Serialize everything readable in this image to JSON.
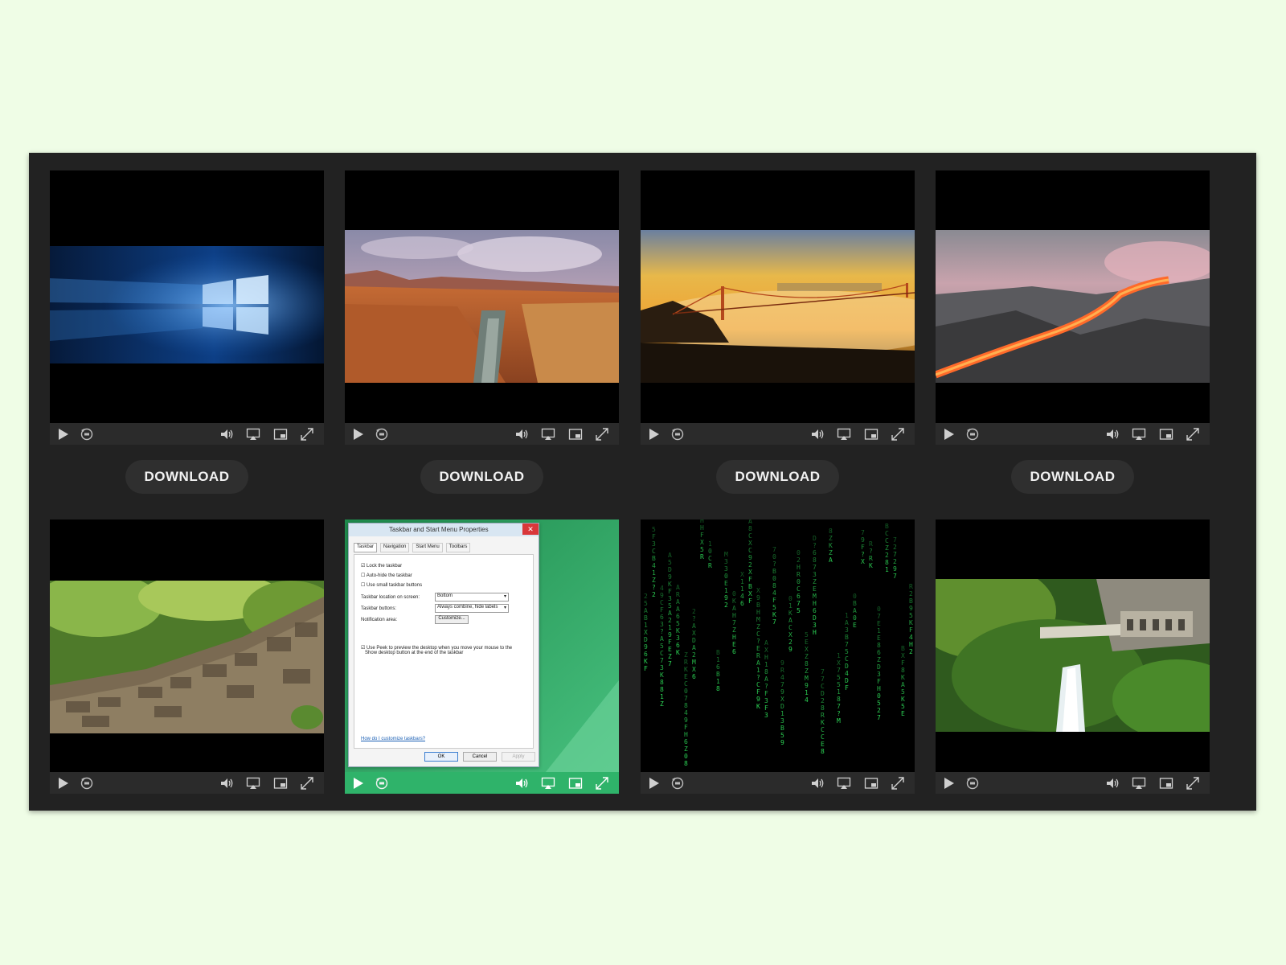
{
  "gallery": {
    "download_label": "DOWNLOAD",
    "videos": [
      {
        "id": "windows-10",
        "scene": "windows-logo"
      },
      {
        "id": "canyon",
        "scene": "desert-canyon"
      },
      {
        "id": "golden-gate",
        "scene": "golden-gate-fog"
      },
      {
        "id": "lava",
        "scene": "lava-flow"
      },
      {
        "id": "stone-wall",
        "scene": "stone-wall"
      },
      {
        "id": "taskbar-dialog",
        "scene": "windows-dialog"
      },
      {
        "id": "matrix",
        "scene": "matrix-rain"
      },
      {
        "id": "waterfall",
        "scene": "waterfall"
      }
    ],
    "controls": [
      "play-icon",
      "replay-30-icon",
      "volume-icon",
      "airplay-icon",
      "picture-in-picture-icon",
      "fullscreen-icon"
    ]
  },
  "dialog": {
    "title": "Taskbar and Start Menu Properties",
    "tabs": [
      "Taskbar",
      "Navigation",
      "Start Menu",
      "Toolbars"
    ],
    "options": [
      "Lock the taskbar",
      "Auto-hide the taskbar",
      "Use small taskbar buttons"
    ],
    "location_label": "Taskbar location on screen:",
    "location_value": "Bottom",
    "buttons_label": "Taskbar buttons:",
    "buttons_value": "Always combine, hide labels",
    "notification_label": "Notification area:",
    "customize_label": "Customize...",
    "peek_text_1": "Use Peek to preview the desktop when you move your mouse to the",
    "peek_text_2": "Show desktop button at the end of the taskbar",
    "help_link": "How do I customize taskbars?",
    "ok": "OK",
    "cancel": "Cancel",
    "apply": "Apply"
  },
  "colors": {
    "page_background": "#effde6",
    "panel_background": "#222222",
    "button_background": "#2f2f2f",
    "matrix_green": "#2fe05a"
  }
}
